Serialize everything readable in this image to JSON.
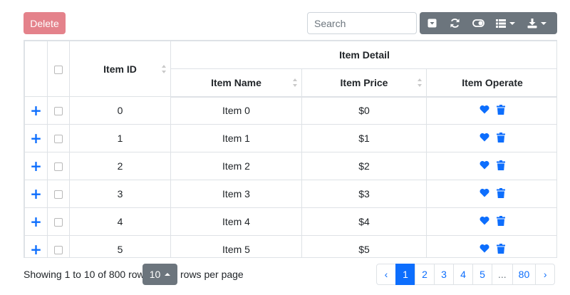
{
  "toolbar": {
    "delete_label": "Delete",
    "search_placeholder": "Search",
    "buttons": [
      "pagination-toggle-icon",
      "refresh-icon",
      "toggle-view-icon",
      "columns-icon",
      "export-icon"
    ]
  },
  "table": {
    "headers": {
      "item_id": "Item ID",
      "item_detail": "Item Detail",
      "item_name": "Item Name",
      "item_price": "Item Price",
      "item_operate": "Item Operate"
    },
    "rows": [
      {
        "id": "0",
        "name": "Item 0",
        "price": "$0"
      },
      {
        "id": "1",
        "name": "Item 1",
        "price": "$1"
      },
      {
        "id": "2",
        "name": "Item 2",
        "price": "$2"
      },
      {
        "id": "3",
        "name": "Item 3",
        "price": "$3"
      },
      {
        "id": "4",
        "name": "Item 4",
        "price": "$4"
      },
      {
        "id": "5",
        "name": "Item 5",
        "price": "$5"
      }
    ],
    "expand_symbol": "+"
  },
  "footer": {
    "showing_text": "Showing 1 to 10 of 800 rows",
    "page_size": "10",
    "rows_per_page_text": "rows per page",
    "pages": [
      "‹",
      "1",
      "2",
      "3",
      "4",
      "5",
      "...",
      "80",
      "›"
    ],
    "active_page": "1"
  },
  "colors": {
    "accent": "#0d6efd",
    "delete_button": "#e4828b",
    "toolbar_button": "#6c757d"
  }
}
